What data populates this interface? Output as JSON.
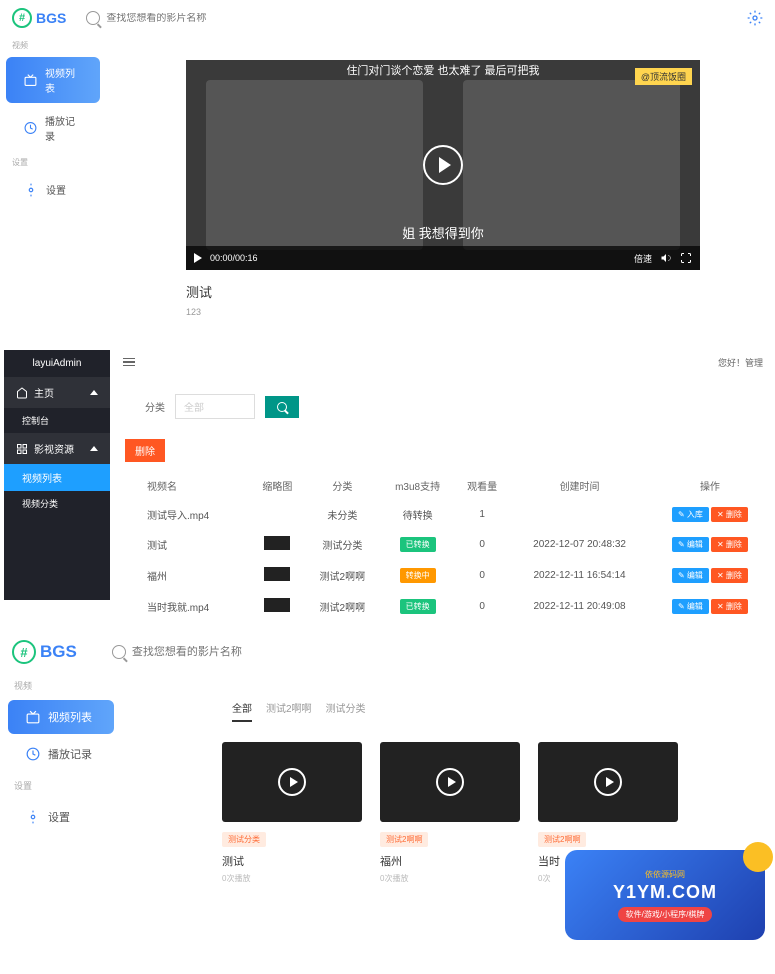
{
  "app": {
    "logo_text": "BGS",
    "search_placeholder": "查找您想看的影片名称"
  },
  "sidebar": {
    "section1_label": "视频",
    "item1_label": "视频列表",
    "item2_label": "播放记录",
    "section2_label": "设置",
    "item3_label": "设置"
  },
  "player": {
    "caption_top": "住门对门谈个恋爱 也太难了 最后可把我",
    "watermark": "@顶流饭圈",
    "caption_bottom": "姐 我想得到你",
    "time": "00:00/00:16",
    "speed": "倍速",
    "title": "测试",
    "desc": "123"
  },
  "admin": {
    "brand": "layuiAdmin",
    "menu_home": "主页",
    "menu_console": "控制台",
    "menu_video": "影视资源",
    "menu_videolist": "视频列表",
    "menu_videocat": "视频分类",
    "greeting": "您好！管理",
    "filter_label": "分类",
    "filter_placeholder": "全部",
    "delete_btn": "删除",
    "headers": {
      "name": "视频名",
      "thumb": "缩略图",
      "cat": "分类",
      "m3u8": "m3u8支持",
      "views": "观看量",
      "created": "创建时间",
      "ops": "操作"
    },
    "rows": [
      {
        "name": "测试导入.mp4",
        "thumb": "",
        "cat": "未分类",
        "m3u8": "待转换",
        "m3u8_class": "",
        "views": "1",
        "created": "",
        "op1": "入库",
        "op1_class": "btn-blue"
      },
      {
        "name": "测试",
        "thumb": "1",
        "cat": "测试分类",
        "m3u8": "已转换",
        "m3u8_class": "badge-green",
        "views": "0",
        "created": "2022-12-07 20:48:32",
        "op1": "编辑",
        "op1_class": "btn-blue"
      },
      {
        "name": "福州",
        "thumb": "1",
        "cat": "测试2啊啊",
        "m3u8": "转换中",
        "m3u8_class": "badge-orange",
        "views": "0",
        "created": "2022-12-11 16:54:14",
        "op1": "编辑",
        "op1_class": "btn-blue"
      },
      {
        "name": "当时我就.mp4",
        "thumb": "1",
        "cat": "测试2啊啊",
        "m3u8": "已转换",
        "m3u8_class": "badge-green",
        "views": "0",
        "created": "2022-12-11 20:49:08",
        "op1": "编辑",
        "op1_class": "btn-blue"
      }
    ],
    "op_delete": "删除"
  },
  "grid": {
    "tabs": {
      "all": "全部",
      "t2": "测试2啊啊",
      "t3": "测试分类"
    },
    "cards": [
      {
        "tag": "测试分类",
        "title": "测试",
        "meta": "0次播放"
      },
      {
        "tag": "测试2啊啊",
        "title": "福州",
        "meta": "0次播放"
      },
      {
        "tag": "测试2啊啊",
        "title": "当时",
        "meta": "0次"
      }
    ]
  },
  "promo": {
    "sub": "依依源码网",
    "main": "Y1YM.COM",
    "tag": "软件/游戏/小程序/棋牌"
  }
}
